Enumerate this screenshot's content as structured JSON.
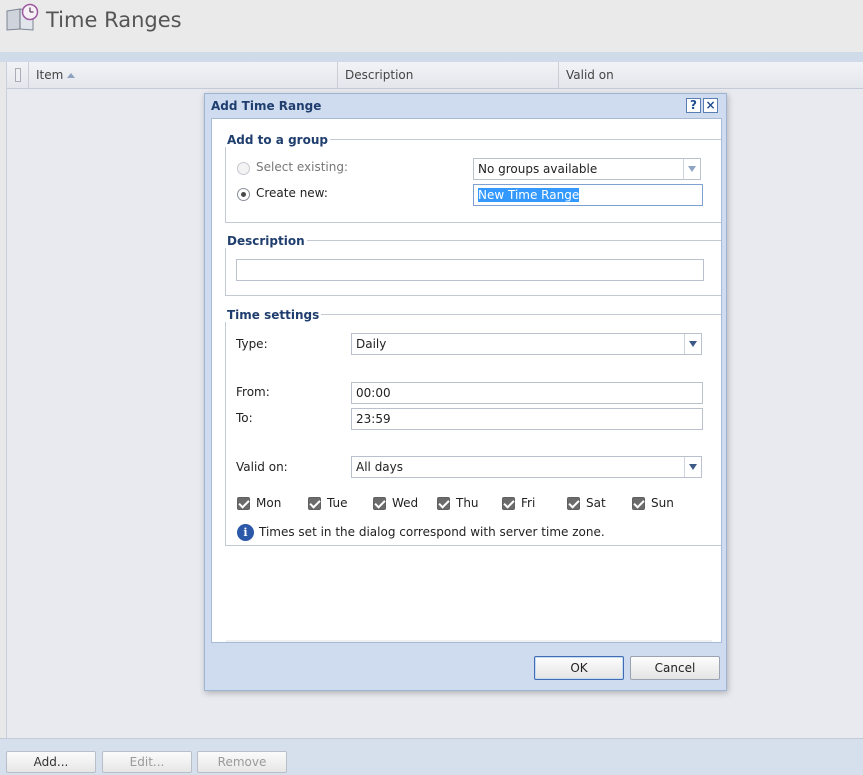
{
  "page": {
    "title": "Time Ranges",
    "icon": "time-ranges-book-clock-icon"
  },
  "grid": {
    "columns": [
      {
        "label": "Item",
        "sort": "ascending"
      },
      {
        "label": "Description"
      },
      {
        "label": "Valid on"
      }
    ]
  },
  "bottom_bar": {
    "add_label": "Add...",
    "edit_label": "Edit...",
    "remove_label": "Remove"
  },
  "dialog": {
    "title": "Add Time Range",
    "help_label": "?",
    "close_label": "×",
    "group": {
      "legend": "Add to a group",
      "select_existing_label": "Select existing:",
      "select_existing_value": "No groups available",
      "create_new_label": "Create new:",
      "create_new_value": "New Time Range",
      "selected_option": "create_new"
    },
    "description": {
      "legend": "Description",
      "value": ""
    },
    "time_settings": {
      "legend": "Time settings",
      "type_label": "Type:",
      "type_value": "Daily",
      "from_label": "From:",
      "from_value": "00:00",
      "to_label": "To:",
      "to_value": "23:59",
      "valid_on_label": "Valid on:",
      "valid_on_value": "All days",
      "days": [
        {
          "label": "Mon",
          "checked": true
        },
        {
          "label": "Tue",
          "checked": true
        },
        {
          "label": "Wed",
          "checked": true
        },
        {
          "label": "Thu",
          "checked": true
        },
        {
          "label": "Fri",
          "checked": true
        },
        {
          "label": "Sat",
          "checked": true
        },
        {
          "label": "Sun",
          "checked": true
        }
      ],
      "info_icon": "info-icon",
      "info_text": "Times set in the dialog correspond with server time zone."
    },
    "ok_label": "OK",
    "cancel_label": "Cancel"
  }
}
